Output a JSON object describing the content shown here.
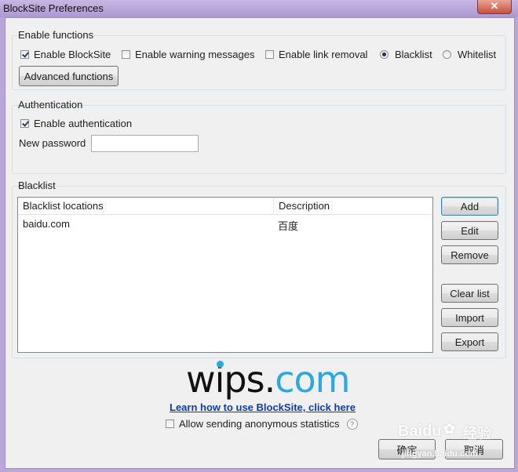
{
  "window": {
    "title": "BlockSite Preferences",
    "close_glyph": "✕"
  },
  "enable_functions": {
    "label": "Enable functions",
    "enable_blocksite": {
      "label": "Enable BlockSite",
      "checked": true
    },
    "enable_warning": {
      "label": "Enable warning messages",
      "checked": false
    },
    "enable_link_removal": {
      "label": "Enable link removal",
      "checked": false
    },
    "blacklist_radio": {
      "label": "Blacklist",
      "selected": true
    },
    "whitelist_radio": {
      "label": "Whitelist",
      "selected": false
    },
    "advanced_button": "Advanced functions"
  },
  "authentication": {
    "label": "Authentication",
    "enable_auth": {
      "label": "Enable authentication",
      "checked": true
    },
    "password_label": "New password",
    "password_value": ""
  },
  "blacklist": {
    "label": "Blacklist",
    "columns": [
      "Blacklist locations",
      "Description"
    ],
    "rows": [
      {
        "location": "baidu.com",
        "description": "百度"
      }
    ],
    "buttons": {
      "add": "Add",
      "edit": "Edit",
      "remove": "Remove",
      "clear": "Clear list",
      "import": "Import",
      "export": "Export"
    }
  },
  "footer": {
    "logo_dark": "wips.",
    "logo_blue": "com",
    "link": "Learn how to use BlockSite, click here",
    "allow_stats": {
      "label": "Allow sending anonymous statistics",
      "checked": false
    },
    "help_glyph": "?",
    "ok_button": "确定",
    "cancel_button": "取消"
  },
  "watermark": {
    "brand": "Baidu",
    "cn": "经验",
    "url": "jingyan.baidu.com"
  },
  "colors": {
    "accent": "#29a9e0",
    "link": "#0b3ea8",
    "titlebar": "#b9a7d8",
    "close": "#c7513a"
  }
}
